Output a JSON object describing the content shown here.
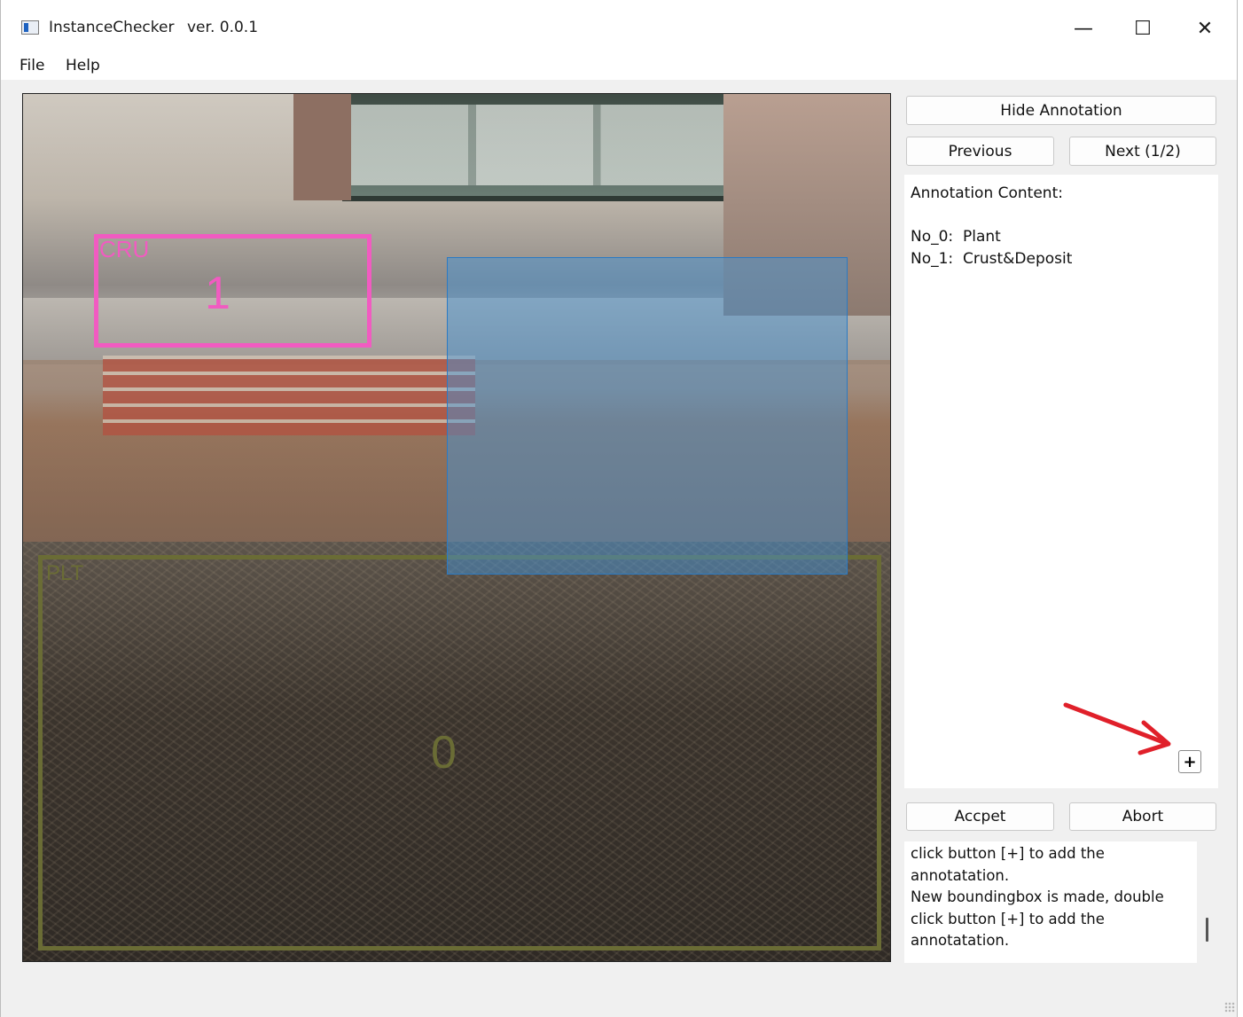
{
  "window": {
    "app_name": "InstanceChecker",
    "version": "ver.  0.0.1",
    "minimize_glyph": "—",
    "maximize_glyph": "☐",
    "close_glyph": "✕"
  },
  "menu": {
    "file": "File",
    "help": "Help"
  },
  "image": {
    "annotations": [
      {
        "id": "1",
        "label_prefix": "CRU",
        "class": "Crust&Deposit",
        "color": "#f15bc1"
      },
      {
        "id": "0",
        "label_prefix": "PLT",
        "class": "Plant",
        "color": "#6a6c35"
      }
    ],
    "new_box_color": "#4292d6"
  },
  "controls": {
    "hide_annotation": "Hide Annotation",
    "previous": "Previous",
    "next": "Next (1/2)",
    "accept": "Accpet",
    "abort": "Abort",
    "add": "+"
  },
  "content": {
    "title": "Annotation Content:",
    "items": [
      {
        "key": "No_0:",
        "value": "Plant"
      },
      {
        "key": "No_1:",
        "value": "Crust&Deposit"
      }
    ]
  },
  "log": {
    "lines": [
      "click button [+] to add the",
      "annotatation.",
      "New boundingbox is made, double",
      "click button [+] to add the",
      "annotatation."
    ]
  },
  "colors": {
    "arrow": "#e0202a"
  }
}
